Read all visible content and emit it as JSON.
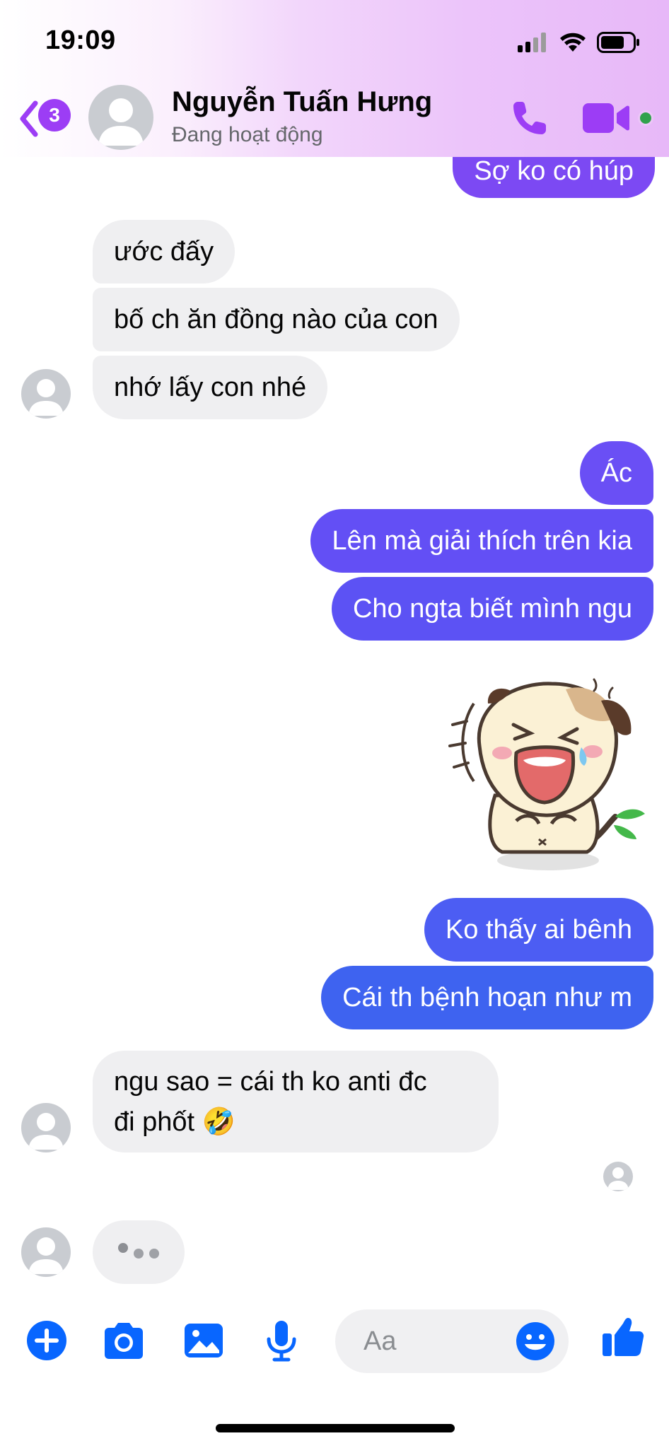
{
  "status_bar": {
    "time": "19:09"
  },
  "header": {
    "back_badge": "3",
    "contact_name": "Nguyễn Tuấn Hưng",
    "contact_status": "Đang hoạt động",
    "icons": [
      "back-chevron-icon",
      "phone-icon",
      "video-camera-icon",
      "online-dot"
    ]
  },
  "messages": [
    {
      "from": "me",
      "text": "Sợ ko có húp"
    },
    {
      "from": "them",
      "text": "ước đấy"
    },
    {
      "from": "them",
      "text": "bố ch ăn đồng nào của con"
    },
    {
      "from": "them",
      "text": "nhớ lấy con nhé"
    },
    {
      "from": "me",
      "text": "Ác"
    },
    {
      "from": "me",
      "text": "Lên mà giải thích trên kia"
    },
    {
      "from": "me",
      "text": "Cho ngta biết mình ngu"
    },
    {
      "from": "me",
      "type": "sticker",
      "sticker": "laughing-dog-sticker"
    },
    {
      "from": "me",
      "text": "Ko thấy ai bênh"
    },
    {
      "from": "me",
      "text": "Cái th bệnh hoạn như m"
    },
    {
      "from": "them",
      "line1": "ngu sao = cái th ko anti đc",
      "line2": "đi phốt",
      "emoji": "🤣"
    },
    {
      "from": "them",
      "type": "typing-indicator"
    }
  ],
  "composer": {
    "placeholder": "Aa",
    "icons": [
      "plus-icon",
      "camera-icon",
      "image-icon",
      "microphone-icon",
      "emoji-icon",
      "thumbs-up-icon"
    ]
  },
  "colors": {
    "accent": "#0866ff",
    "outgoing_purple": "#6a4df5",
    "outgoing_blue": "#3e63f0",
    "incoming": "#efeff1",
    "header_gradient_end": "#e7b8f8",
    "online": "#31a24c"
  }
}
